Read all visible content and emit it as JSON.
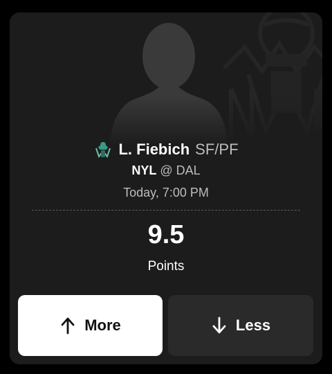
{
  "player": {
    "name": "L. Fiebich",
    "position": "SF/PF",
    "team_logo_icon": "liberty-team-logo-icon",
    "silhouette_icon": "player-silhouette-icon"
  },
  "matchup": {
    "home_team": "NYL",
    "separator": "@",
    "away_team": "DAL"
  },
  "game_time": "Today, 7:00 PM",
  "projection": {
    "line": "9.5",
    "stat": "Points"
  },
  "buttons": {
    "more_label": "More",
    "more_icon": "arrow-up-icon",
    "less_label": "Less",
    "less_icon": "arrow-down-icon"
  },
  "colors": {
    "card_background": "#1c1c1c",
    "page_background": "#000000",
    "more_button": "#ffffff",
    "less_button": "#2a2a2a",
    "team_accent": "#3a9a86"
  }
}
